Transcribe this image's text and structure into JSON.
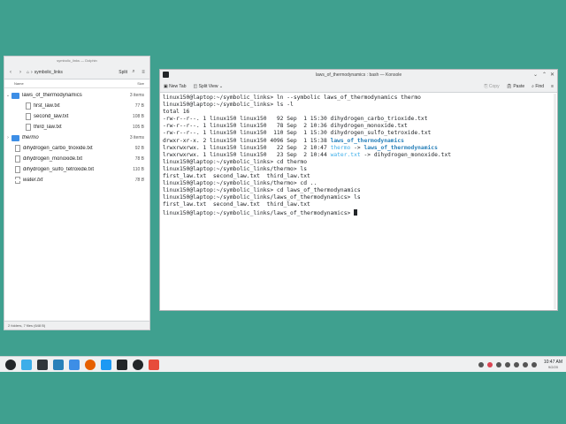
{
  "file_manager": {
    "title": "symbolic_links — Dolphin",
    "breadcrumb": "symbolic_links",
    "split_label": "Split",
    "columns": {
      "name": "Name",
      "size": "Size"
    },
    "items": [
      {
        "name": "laws_of_thermodynamics",
        "size": "3 items",
        "kind": "folder",
        "expanded": true,
        "level": 0
      },
      {
        "name": "first_law.txt",
        "size": "77 B",
        "kind": "file",
        "level": 1
      },
      {
        "name": "second_law.txt",
        "size": "108 B",
        "kind": "file",
        "level": 1
      },
      {
        "name": "third_law.txt",
        "size": "105 B",
        "kind": "file",
        "level": 1
      },
      {
        "name": "thermo",
        "size": "3 items",
        "kind": "folder-link",
        "level": 0
      },
      {
        "name": "dihydrogen_carbo_trioxide.txt",
        "size": "92 B",
        "kind": "file",
        "level": 0
      },
      {
        "name": "dihydrogen_monoxide.txt",
        "size": "78 B",
        "kind": "file",
        "level": 0
      },
      {
        "name": "dihydrogen_sulfo_tetroxide.txt",
        "size": "110 B",
        "kind": "file",
        "level": 0
      },
      {
        "name": "water.txt",
        "size": "78 B",
        "kind": "file-link",
        "level": 0
      }
    ],
    "status": "2 folders, 7 files (648 B)"
  },
  "terminal": {
    "title": "laws_of_thermodynamics : bash — Konsole",
    "toolbar": {
      "new_tab": "New Tab",
      "split_view": "Split View",
      "copy": "Copy",
      "paste": "Paste",
      "find": "Find"
    },
    "lines": [
      "linux150@laptop:~/symbolic_links> ln --symbolic laws_of_thermodynamics thermo",
      "linux150@laptop:~/symbolic_links> ls -l",
      "total 16",
      "-rw-r--r--. 1 linux150 linux150   92 Sep  1 15:30 dihydrogen_carbo_trioxide.txt",
      "-rw-r--r--. 1 linux150 linux150   78 Sep  2 10:36 dihydrogen_monoxide.txt",
      "-rw-r--r--. 1 linux150 linux150  110 Sep  1 15:30 dihydrogen_sulfo_tetroxide.txt",
      "drwxr-xr-x. 2 linux150 linux150 4096 Sep  1 15:38 ",
      "lrwxrwxrwx. 1 linux150 linux150   22 Sep  2 10:47 ",
      "lrwxrwxrwx. 1 linux150 linux150   23 Sep  2 10:44 ",
      "linux150@laptop:~/symbolic_links> cd thermo",
      "linux150@laptop:~/symbolic_links/thermo> ls",
      "first_law.txt  second_law.txt  third_law.txt",
      "linux150@laptop:~/symbolic_links/thermo> cd ..",
      "linux150@laptop:~/symbolic_links> cd laws_of_thermodynamics",
      "linux150@laptop:~/symbolic_links/laws_of_thermodynamics> ls",
      "first_law.txt  second_law.txt  third_law.txt",
      "linux150@laptop:~/symbolic_links/laws_of_thermodynamics> "
    ],
    "colored": {
      "dir_name": "laws_of_thermodynamics",
      "link1_name": "thermo",
      "link1_arrow": " -> ",
      "link1_target": "laws_of_thermodynamics",
      "link2_name": "water.txt",
      "link2_arrow": " -> ",
      "link2_target": "dihydrogen_monoxide.txt"
    }
  },
  "taskbar": {
    "time": "10:47 AM",
    "date": "9/2/20"
  },
  "colors": {
    "desktop": "#3fa08f",
    "dir": "#2980b9",
    "link": "#3daee9",
    "link_target": "#8e44ad"
  }
}
